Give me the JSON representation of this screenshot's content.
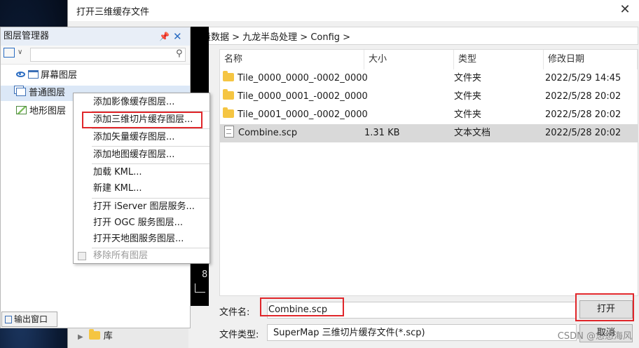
{
  "dialog": {
    "title": "打开三维缓存文件",
    "breadcrumb": "影测量数据 > 九龙半岛处理 > Config >",
    "columns": [
      "名称",
      "大小",
      "类型",
      "修改日期"
    ],
    "files": [
      {
        "name": "Tile_0000_0000_-0002_0000",
        "size": "",
        "type": "文件夹",
        "date": "2022/5/29 14:45",
        "kind": "folder"
      },
      {
        "name": "Tile_0000_0001_-0002_0000",
        "size": "",
        "type": "文件夹",
        "date": "2022/5/28 20:02",
        "kind": "folder"
      },
      {
        "name": "Tile_0001_0000_-0002_0000",
        "size": "",
        "type": "文件夹",
        "date": "2022/5/28 20:02",
        "kind": "folder"
      },
      {
        "name": "Combine.scp",
        "size": "1.31 KB",
        "type": "文本文档",
        "date": "2022/5/28 20:02",
        "kind": "doc",
        "selected": true
      }
    ],
    "filename_label": "文件名:",
    "filename_value": "Combine.scp",
    "filetype_label": "文件类型:",
    "filetype_value": "SuperMap 三维切片缓存文件(*.scp)",
    "open_label": "打开",
    "cancel_label": "取消",
    "nav_library": "库"
  },
  "layer_panel": {
    "title": "图层管理器",
    "tree": [
      {
        "label": "屏幕图层",
        "icon": "window-icon"
      },
      {
        "label": "普通图层",
        "icon": "layers-icon"
      },
      {
        "label": "地形图层",
        "icon": "terrain-icon"
      }
    ],
    "bottom_tab": "输出窗口",
    "scene_fragment": "8"
  },
  "context_menu": {
    "items": [
      {
        "label": "添加影像缓存图层..."
      },
      {
        "label": "添加三维切片缓存图层...",
        "highlighted": true
      },
      {
        "label": "添加矢量缓存图层..."
      },
      {
        "label": "添加地图缓存图层..."
      },
      {
        "label": "加载 KML..."
      },
      {
        "label": "新建 KML..."
      },
      {
        "label": "打开 iServer 图层服务..."
      },
      {
        "label": "打开 OGC 服务图层..."
      },
      {
        "label": "打开天地图服务图层..."
      },
      {
        "label": "移除所有图层",
        "disabled": true
      }
    ]
  },
  "watermark": "CSDN @悠悠海风",
  "colors": {
    "highlight_border": "#e0262a",
    "accent": "#2a6cc2"
  }
}
